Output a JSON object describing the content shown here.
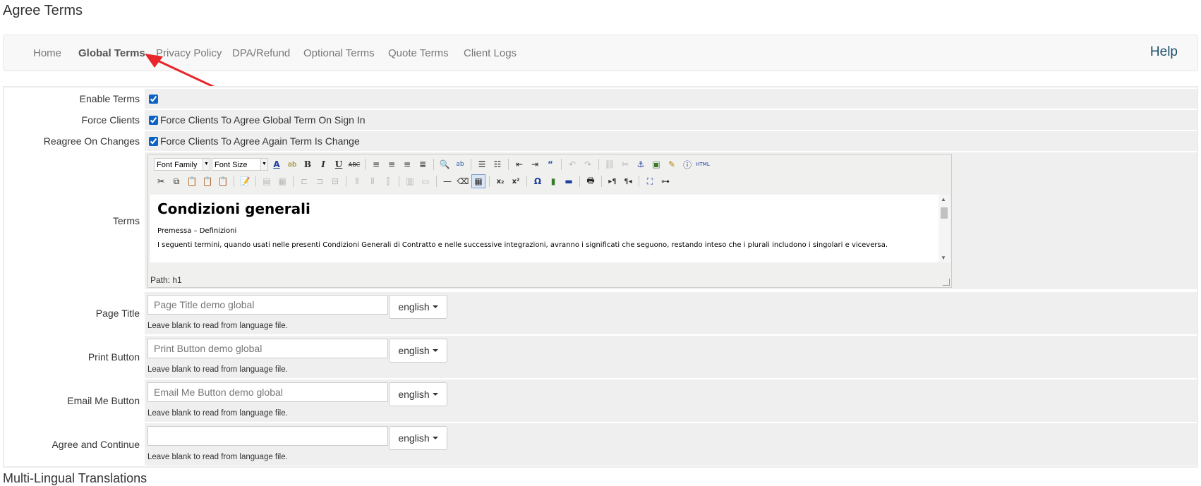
{
  "page": {
    "title": "Agree Terms",
    "section_title": "Multi-Lingual Translations"
  },
  "nav": {
    "items": [
      {
        "label": "Home",
        "active": false
      },
      {
        "label": "Global Terms",
        "active": true
      },
      {
        "label": "Privacy Policy",
        "active": false
      },
      {
        "label": "DPA/Refund",
        "active": false
      },
      {
        "label": "Optional Terms",
        "active": false
      },
      {
        "label": "Quote Terms",
        "active": false
      },
      {
        "label": "Client Logs",
        "active": false
      }
    ],
    "help": "Help"
  },
  "form": {
    "enable_terms": {
      "label": "Enable Terms",
      "checked": true
    },
    "force_clients": {
      "label": "Force Clients",
      "checked": true,
      "text": "Force Clients To Agree Global Term On Sign In"
    },
    "reagree": {
      "label": "Reagree On Changes",
      "checked": true,
      "text": "Force Clients To Agree Again Term Is Change"
    },
    "terms": {
      "label": "Terms",
      "font_family": "Font Family",
      "font_size": "Font Size",
      "content_heading": "Condizioni generali",
      "content_p1": "Premessa – Definizioni",
      "content_p2": "I seguenti termini, quando usati nelle presenti Condizioni Generali di Contratto e nelle successive integrazioni, avranno i significati che seguono, restando inteso che i plurali includono i singolari e viceversa.",
      "path": "Path: h1"
    },
    "page_title": {
      "label": "Page Title",
      "placeholder": "Page Title demo global",
      "lang": "english",
      "help": "Leave blank to read from language file."
    },
    "print_button": {
      "label": "Print Button",
      "placeholder": "Print Button demo global",
      "lang": "english",
      "help": "Leave blank to read from language file."
    },
    "email_button": {
      "label": "Email Me Button",
      "placeholder": "Email Me Button demo global",
      "lang": "english",
      "help": "Leave blank to read from language file."
    },
    "agree_continue": {
      "label": "Agree and Continue",
      "placeholder": "",
      "lang": "english",
      "help": "Leave blank to read from language file."
    }
  },
  "colors": {
    "annotation_arrow": "#e8262b",
    "help_link": "#1a4e66",
    "field_bg": "#efefef"
  }
}
